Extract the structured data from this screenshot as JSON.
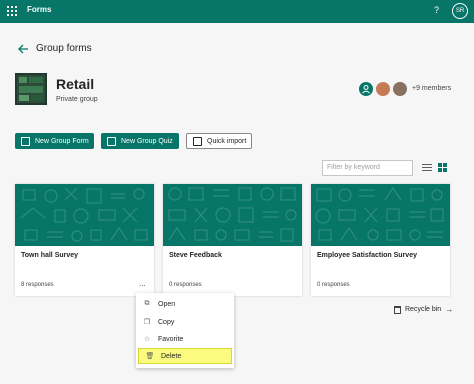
{
  "topbar": {
    "app_name": "Forms",
    "help_label": "?",
    "user_initials": "SR"
  },
  "page": {
    "title": "Group forms"
  },
  "group": {
    "name": "Retail",
    "subtitle": "Private group",
    "members_label": "+9 members"
  },
  "actions": {
    "new_group_form": "New Group Form",
    "new_group_quiz": "New Group Quiz",
    "quick_import": "Quick import"
  },
  "filter": {
    "placeholder": "Filter by keyword"
  },
  "cards": [
    {
      "title": "Town hall Survey",
      "responses": "8 responses",
      "more": "..."
    },
    {
      "title": "Steve Feedback",
      "responses": "0 responses"
    },
    {
      "title": "Employee Satisfaction Survey",
      "responses": "0 responses"
    }
  ],
  "recycle": {
    "label": "Recycle bin"
  },
  "context_menu": {
    "items": [
      "Open",
      "Copy",
      "Favorite",
      "Delete"
    ],
    "highlighted": "Delete"
  },
  "colors": {
    "brand": "#077568",
    "highlight": "#fbfc7f"
  }
}
